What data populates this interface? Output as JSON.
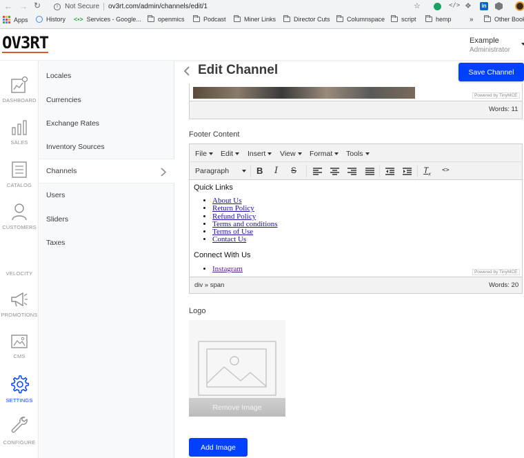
{
  "browser": {
    "security": "Not Secure",
    "url": "ov3rt.com/admin/channels/edit/1",
    "bookmarks": [
      "Apps",
      "History",
      "Services - Google...",
      "openmics",
      "Podcast",
      "Miner Links",
      "Director Cuts",
      "Columnspace",
      "script",
      "hemp",
      "»",
      "Other Book"
    ]
  },
  "header": {
    "logo": "OV3RT",
    "user_name": "Example",
    "user_role": "Administrator"
  },
  "nav": {
    "dashboard": "DASHBOARD",
    "sales": "SALES",
    "catalog": "CATALOG",
    "customers": "CUSTOMERS",
    "velocity": "VELOCITY",
    "promotions": "PROMOTIONS",
    "cms": "CMS",
    "settings": "SETTINGS",
    "configure": "CONFIGURE"
  },
  "submenu": [
    "Locales",
    "Currencies",
    "Exchange Rates",
    "Inventory Sources",
    "Channels",
    "Users",
    "Sliders",
    "Taxes"
  ],
  "page": {
    "title": "Edit Channel",
    "save_label": "Save Channel"
  },
  "top_editor": {
    "powered": "Powered by TinyMCE",
    "words": "Words: 11"
  },
  "footer_editor": {
    "label": "Footer Content",
    "menus": [
      "File",
      "Edit",
      "Insert",
      "View",
      "Format",
      "Tools"
    ],
    "block_format": "Paragraph",
    "heading1": "Quick Links",
    "links": [
      "About Us",
      "Return Policy",
      "Refund Policy",
      "Terms and conditions",
      "Terms of Use",
      "Contact Us"
    ],
    "heading2": "Connect With Us",
    "social_link": "Instagram",
    "powered": "Powered by TinyMCE",
    "path": "div » span",
    "words": "Words: 20"
  },
  "logo_section": {
    "label": "Logo",
    "remove_label": "Remove Image",
    "add_label": "Add Image"
  },
  "colors": {
    "primary": "#0041ff",
    "settings_active": "#0041ff",
    "logo_underline": "#d8582a"
  }
}
